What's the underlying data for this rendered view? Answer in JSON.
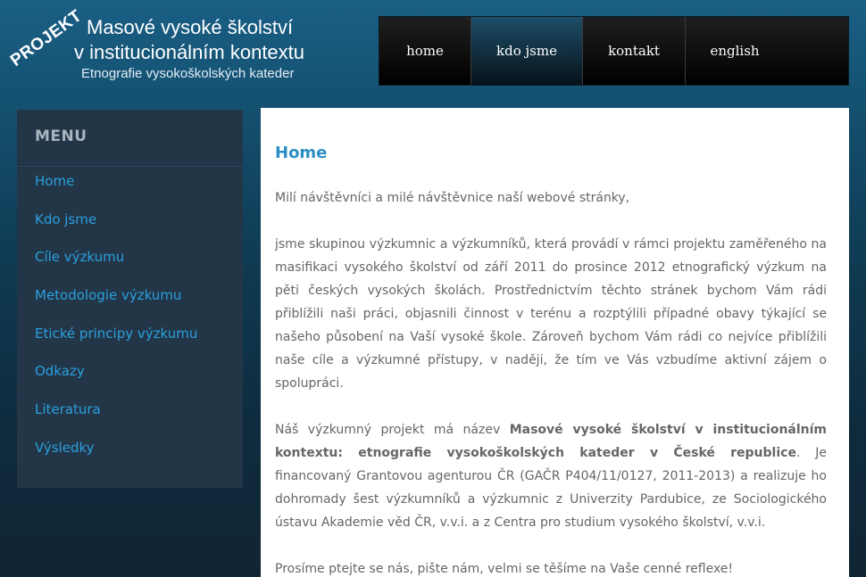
{
  "header": {
    "badge": "PROJEKT",
    "title_line1": "Masové vysoké školství",
    "title_line2": "v institucionálním kontextu",
    "subtitle": "Etnografie vysokoškolských kateder"
  },
  "nav": [
    {
      "label": "home",
      "active": false
    },
    {
      "label": "kdo jsme",
      "active": true
    },
    {
      "label": "kontakt",
      "active": false
    },
    {
      "label": "english",
      "active": false
    }
  ],
  "sidebar": {
    "title": "MENU",
    "items": [
      "Home",
      "Kdo jsme",
      "Cíle výzkumu",
      "Metodologie výzkumu",
      "Etické principy výzkumu",
      "Odkazy",
      "Literatura",
      "Výsledky"
    ]
  },
  "content": {
    "heading": "Home",
    "greeting": "Milí návštěvníci a milé návštěvnice naší webové stránky,",
    "paragraph1": "jsme skupinou výzkumnic a výzkumníků, která provádí v rámci projektu zaměřeného na masifikaci vysokého školství od září 2011 do prosince 2012 etnografický výzkum na pěti českých vysokých školách. Prostřednictvím těchto stránek bychom Vám rádi přiblížili naši práci, objasnili činnost v terénu a rozptýlili případné obavy týkající se našeho působení na Vaší vysoké škole. Zároveň bychom Vám rádi co nejvíce přiblížili naše cíle a výzkumné přístupy, v naději, že tím ve Vás vzbudíme aktivní zájem o spolupráci.",
    "paragraph2_start": "Náš výzkumný projekt má název ",
    "paragraph2_bold": "Masové vysoké školství v institucionálním kontextu: etnografie vysokoškolských kateder v České republice",
    "paragraph2_end": ". Je financovaný Grantovou agenturou ČR (GAČR P404/11/0127, 2011-2013) a realizuje ho dohromady šest výzkumníků a výzkumnic z Univerzity Pardubice, ze Sociologického ústavu Akademie věd ČR, v.v.i. a z Centra pro studium vysokého školství, v.v.i.",
    "paragraph3": "Prosíme ptejte se nás, pište nám, velmi se těšíme na Vaše cenné reflexe!"
  }
}
